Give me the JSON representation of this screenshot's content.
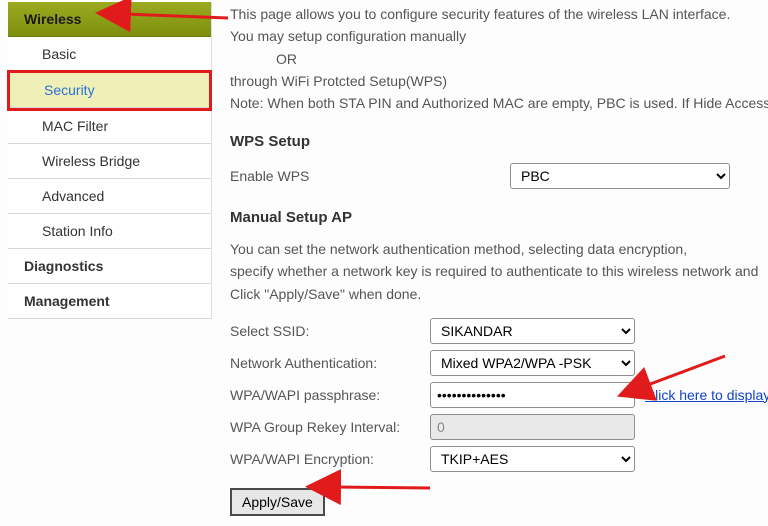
{
  "sidebar": {
    "header": "Wireless",
    "items": [
      {
        "label": "Basic"
      },
      {
        "label": "Security"
      },
      {
        "label": "MAC Filter"
      },
      {
        "label": "Wireless Bridge"
      },
      {
        "label": "Advanced"
      },
      {
        "label": "Station Info"
      }
    ],
    "diagnostics": "Diagnostics",
    "management": "Management"
  },
  "intro": {
    "line1": "This page allows you to configure security features of the wireless LAN interface.",
    "line2": "You may setup configuration manually",
    "or": "OR",
    "line3": "through WiFi Protcted Setup(WPS)",
    "line4": "Note: When both STA PIN and Authorized MAC are empty, PBC is used. If Hide Access "
  },
  "wps": {
    "title": "WPS Setup",
    "enable_label": "Enable WPS",
    "enable_value": "PBC"
  },
  "manual": {
    "title": "Manual Setup AP",
    "desc1": "You can set the network authentication method, selecting data encryption,",
    "desc2": "specify whether a network key is required to authenticate to this wireless network and ",
    "desc3": "Click \"Apply/Save\" when done.",
    "ssid_label": "Select SSID:",
    "ssid_value": "SIKANDAR",
    "auth_label": "Network Authentication:",
    "auth_value": "Mixed WPA2/WPA -PSK",
    "pass_label": "WPA/WAPI passphrase:",
    "pass_value": "••••••••••••••",
    "pass_link": "Click here to display",
    "rekey_label": "WPA Group Rekey Interval:",
    "rekey_value": "0",
    "enc_label": "WPA/WAPI Encryption:",
    "enc_value": "TKIP+AES",
    "apply": "Apply/Save"
  }
}
